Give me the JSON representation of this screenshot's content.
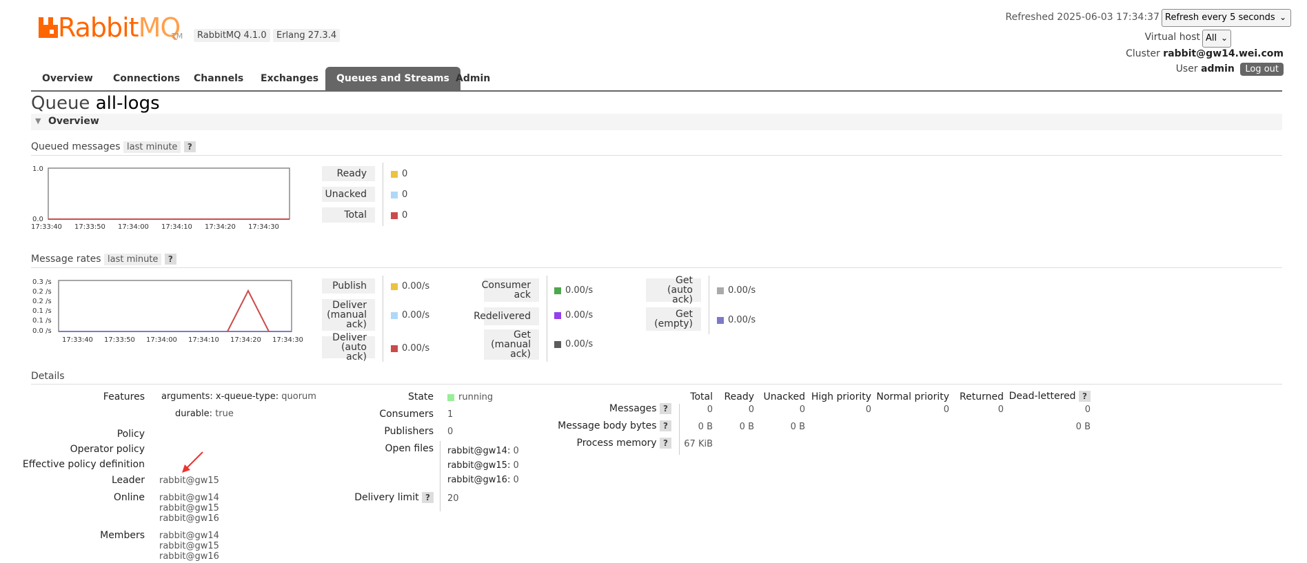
{
  "brand": {
    "rabbit": "Rabbit",
    "mq": "MQ",
    "tm": "TM"
  },
  "header": {
    "version": "RabbitMQ 4.1.0",
    "erlang": "Erlang 27.3.4",
    "refreshed": "Refreshed 2025-06-03 17:34:37",
    "refresh_select": "Refresh every 5 seconds",
    "vhost_label": "Virtual host",
    "vhost_value": "All",
    "cluster_label": "Cluster",
    "cluster_value": "rabbit@gw14.wei.com",
    "user_label": "User",
    "user_value": "admin",
    "logout": "Log out"
  },
  "tabs": [
    "Overview",
    "Connections",
    "Channels",
    "Exchanges",
    "Queues and Streams",
    "Admin"
  ],
  "page": {
    "title_prefix": "Queue",
    "title_name": "all-logs",
    "section": "Overview"
  },
  "queued": {
    "label": "Queued messages",
    "range": "last minute",
    "help": "?",
    "chart_ymax": "1.0",
    "chart_ymin": "0.0",
    "xticks": [
      "17:33:40",
      "17:33:50",
      "17:34:00",
      "17:34:10",
      "17:34:20",
      "17:34:30"
    ],
    "legend": [
      {
        "label": "Ready",
        "value": "0",
        "color": "#edc240"
      },
      {
        "label": "Unacked",
        "value": "0",
        "color": "#afd8f8"
      },
      {
        "label": "Total",
        "value": "0",
        "color": "#cb4b4b"
      }
    ]
  },
  "rates": {
    "label": "Message rates",
    "range": "last minute",
    "help": "?",
    "yticks": [
      "0.3 /s",
      "0.2 /s",
      "0.2 /s",
      "0.1 /s",
      "0.1 /s",
      "0.0 /s"
    ],
    "xticks": [
      "17:33:40",
      "17:33:50",
      "17:34:00",
      "17:34:10",
      "17:34:20",
      "17:34:30"
    ],
    "col1": [
      {
        "label": "Publish",
        "value": "0.00/s",
        "color": "#edc240"
      },
      {
        "label": "Deliver (manual ack)",
        "value": "0.00/s",
        "color": "#afd8f8"
      },
      {
        "label": "Deliver (auto ack)",
        "value": "0.00/s",
        "color": "#cb4b4b"
      }
    ],
    "col2": [
      {
        "label": "Consumer ack",
        "value": "0.00/s",
        "color": "#4da74d"
      },
      {
        "label": "Redelivered",
        "value": "0.00/s",
        "color": "#9440ed"
      },
      {
        "label": "Get (manual ack)",
        "value": "0.00/s",
        "color": "#5c5c5c"
      }
    ],
    "col3": [
      {
        "label": "Get (auto ack)",
        "value": "0.00/s",
        "color": "#aaaaaa"
      },
      {
        "label": "Get (empty)",
        "value": "0.00/s",
        "color": "#7c79c9"
      }
    ]
  },
  "details": {
    "label": "Details",
    "features_label": "Features",
    "arguments_key": "arguments:",
    "arguments_sub": "x-queue-type:",
    "arguments_val": "quorum",
    "durable_key": "durable:",
    "durable_val": "true",
    "policy_label": "Policy",
    "operator_policy_label": "Operator policy",
    "effective_policy_label": "Effective policy definition",
    "leader_label": "Leader",
    "leader_value": "rabbit@gw15",
    "online_label": "Online",
    "online": [
      "rabbit@gw14",
      "rabbit@gw15",
      "rabbit@gw16"
    ],
    "members_label": "Members",
    "members": [
      "rabbit@gw14",
      "rabbit@gw15",
      "rabbit@gw16"
    ],
    "state_label": "State",
    "state_value": "running",
    "state_color": "#99ee99",
    "consumers_label": "Consumers",
    "consumers_value": "1",
    "publishers_label": "Publishers",
    "publishers_value": "0",
    "open_files_label": "Open files",
    "open_files": [
      {
        "node": "rabbit@gw14:",
        "value": "0"
      },
      {
        "node": "rabbit@gw15:",
        "value": "0"
      },
      {
        "node": "rabbit@gw16:",
        "value": "0"
      }
    ],
    "delivery_limit_label": "Delivery limit",
    "delivery_limit_value": "20",
    "table_headers": [
      "Total",
      "Ready",
      "Unacked",
      "High priority",
      "Normal priority",
      "Returned",
      "Dead-lettered"
    ],
    "rows": [
      {
        "label": "Messages",
        "values": [
          "0",
          "0",
          "0",
          "0",
          "0",
          "0",
          "0"
        ]
      },
      {
        "label": "Message body bytes",
        "values": [
          "0 B",
          "0 B",
          "0 B",
          "",
          "",
          "",
          "0 B"
        ]
      },
      {
        "label": "Process memory",
        "values": [
          "67 KiB",
          "",
          "",
          "",
          "",
          "",
          ""
        ]
      }
    ]
  }
}
